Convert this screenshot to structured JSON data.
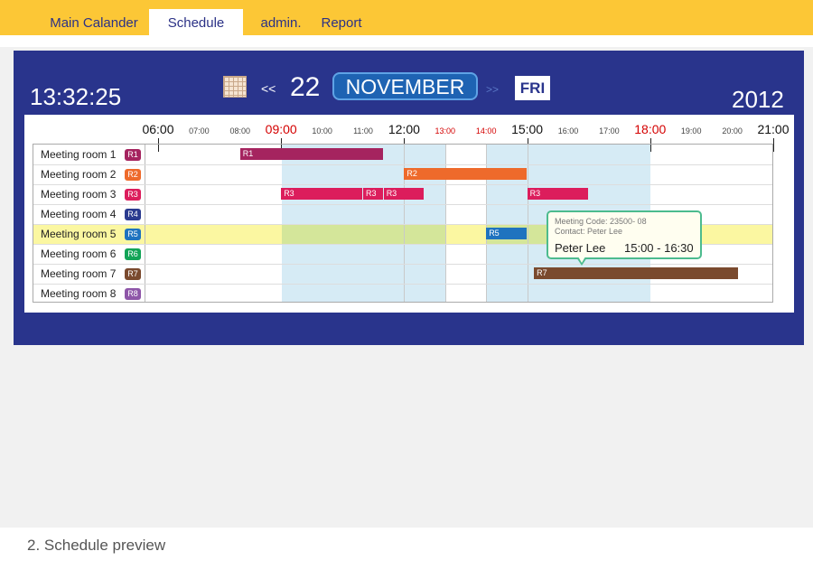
{
  "nav": {
    "tabs": [
      {
        "label": "Main Calander"
      },
      {
        "label": "Schedule",
        "active": true
      },
      {
        "label": "admin."
      },
      {
        "label": "Report"
      }
    ]
  },
  "header": {
    "time": "13:32:25",
    "prev": "<<",
    "day": "22",
    "month": "NOVEMBER",
    "next": ">>",
    "weekday": "FRI",
    "year": "2012"
  },
  "timeline": {
    "ticks": [
      "06:00",
      "07:00",
      "08:00",
      "09:00",
      "10:00",
      "11:00",
      "12:00",
      "13:00",
      "14:00",
      "15:00",
      "16:00",
      "17:00",
      "18:00",
      "19:00",
      "20:00",
      "21:00"
    ]
  },
  "rooms": [
    {
      "name": "Meeting room 1",
      "badge": "R1",
      "color": "#a5245f"
    },
    {
      "name": "Meeting room 2",
      "badge": "R2",
      "color": "#ee6a2b"
    },
    {
      "name": "Meeting room 3",
      "badge": "R3",
      "color": "#dc1d5c"
    },
    {
      "name": "Meeting room 4",
      "badge": "R4",
      "color": "#2b3b8f"
    },
    {
      "name": "Meeting room 5",
      "badge": "R5",
      "color": "#1f73bf"
    },
    {
      "name": "Meeting room 6",
      "badge": "R6",
      "color": "#13a457"
    },
    {
      "name": "Meeting room 7",
      "badge": "R7",
      "color": "#7a4a2e"
    },
    {
      "name": "Meeting room 8",
      "badge": "R8",
      "color": "#8e56a8"
    }
  ],
  "bookings": [
    {
      "room": 0,
      "label": "R1",
      "start": "08:00",
      "end": "11:30"
    },
    {
      "room": 1,
      "label": "R2",
      "start": "12:00",
      "end": "15:00"
    },
    {
      "room": 2,
      "label": "R3",
      "start": "09:00",
      "end": "11:00"
    },
    {
      "room": 2,
      "label": "R3",
      "start": "11:00",
      "end": "11:30"
    },
    {
      "room": 2,
      "label": "R3",
      "start": "11:30",
      "end": "12:30"
    },
    {
      "room": 2,
      "label": "R3",
      "start": "15:00",
      "end": "16:30"
    },
    {
      "room": 4,
      "label": "R5",
      "start": "14:00",
      "end": "15:00"
    },
    {
      "room": 6,
      "label": "R7",
      "start": "15:10",
      "end": "20:10"
    }
  ],
  "tooltip": {
    "meeting_code": "Meeting Code: 23500- 08",
    "contact": "Contact: Peter Lee",
    "name": "Peter Lee",
    "time": "15:00 - 16:30"
  },
  "caption": "2. Schedule preview"
}
